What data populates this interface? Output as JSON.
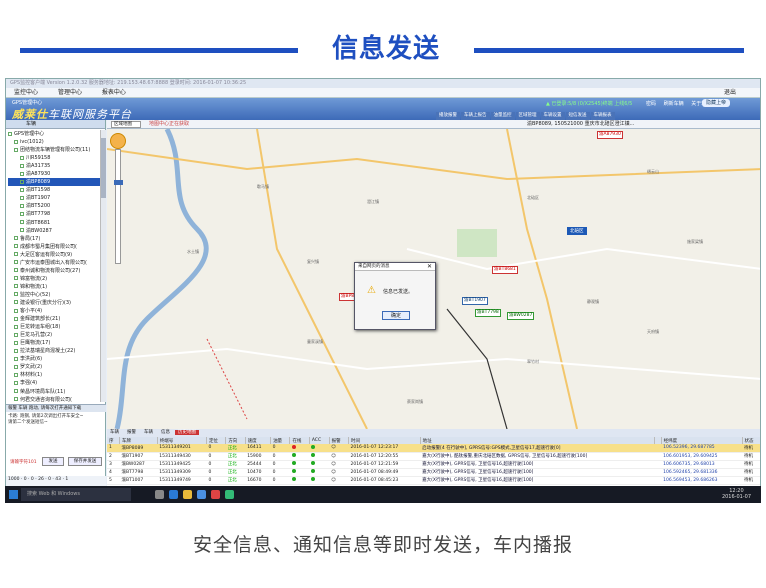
{
  "banner": {
    "title": "信息发送",
    "caption": "安全信息、通知信息等即时发送，车内播报"
  },
  "app": {
    "window_title": "GPS监控客户端 Version 1.2.0.32  服务器地址: 219.153.48.67:8888  登录时间: 2016-01-07 10:36:25",
    "menu": [
      "监控中心",
      "管理中心",
      "报表中心"
    ],
    "exit_label": "退出",
    "header": {
      "gps_label": "GPS管理中心",
      "logo_text": "威莱仕",
      "logo_sub": "车联网服务平台",
      "status_text": "▲ 已登录:5/8 (0/X2545)终端 上线6/5",
      "links": [
        "密码",
        "刷新车辆",
        "关于软件"
      ],
      "online_button": "隐藏上帝"
    },
    "tabs": [
      "播放报警",
      "车辆上报告",
      "油量监控",
      "区域管理",
      "车辆设置",
      "短信发送",
      "车辆报表"
    ],
    "left_panel": {
      "header": "车辆",
      "tree": [
        {
          "label": "GPS管理中心",
          "level": 0,
          "type": "group"
        },
        {
          "label": "ivc(1012)",
          "level": 1,
          "type": "group"
        },
        {
          "label": "团结物流车辆管理有限公司(11)",
          "level": 1,
          "type": "group"
        },
        {
          "label": "川R59158",
          "level": 2,
          "type": "car"
        },
        {
          "label": "渝A31735",
          "level": 2,
          "type": "car"
        },
        {
          "label": "渝A87930",
          "level": 2,
          "type": "car"
        },
        {
          "label": "渝BP8089",
          "level": 2,
          "type": "car",
          "selected": true
        },
        {
          "label": "渝BT1598",
          "level": 2,
          "type": "car"
        },
        {
          "label": "渝BT1907",
          "level": 2,
          "type": "car"
        },
        {
          "label": "渝BT5200",
          "level": 2,
          "type": "car"
        },
        {
          "label": "渝BT7798",
          "level": 2,
          "type": "car"
        },
        {
          "label": "渝BT8681",
          "level": 2,
          "type": "car"
        },
        {
          "label": "渝BW0287",
          "level": 2,
          "type": "car"
        },
        {
          "label": "鲁局(17)",
          "level": 1,
          "type": "group"
        },
        {
          "label": "成都市蜀月集团有限公司(",
          "level": 1,
          "type": "group"
        },
        {
          "label": "大足区客运有限公司(9)",
          "level": 1,
          "type": "group"
        },
        {
          "label": "广安市运泰围城出入有限公司(",
          "level": 1,
          "type": "group"
        },
        {
          "label": "泰州诚和物流有限公司(27)",
          "level": 1,
          "type": "group"
        },
        {
          "label": "锦富物流(2)",
          "level": 1,
          "type": "group"
        },
        {
          "label": "锦和物流(1)",
          "level": 1,
          "type": "group"
        },
        {
          "label": "监控中心(52)",
          "level": 1,
          "type": "group"
        },
        {
          "label": "建设银行(重庆分行)(3)",
          "level": 1,
          "type": "group"
        },
        {
          "label": "客小平(4)",
          "level": 1,
          "type": "group"
        },
        {
          "label": "金辉建筑部长(21)",
          "level": 1,
          "type": "group"
        },
        {
          "label": "巨龙转运车组(18)",
          "level": 1,
          "type": "group"
        },
        {
          "label": "巨龙马孔营(2)",
          "level": 1,
          "type": "group"
        },
        {
          "label": "巨鹰物流(17)",
          "level": 1,
          "type": "group"
        },
        {
          "label": "拉法基瑞星商混凝土(22)",
          "level": 1,
          "type": "group"
        },
        {
          "label": "李洪武(6)",
          "level": 1,
          "type": "group"
        },
        {
          "label": "罗文武(2)",
          "level": 1,
          "type": "group"
        },
        {
          "label": "林材料(1)",
          "level": 1,
          "type": "group"
        },
        {
          "label": "李强(4)",
          "level": 1,
          "type": "group"
        },
        {
          "label": "荣昌环境局车队(11)",
          "level": 1,
          "type": "group"
        },
        {
          "label": "何君交通咨询有限公司(",
          "level": 1,
          "type": "group"
        }
      ],
      "lower_tabs": "報警  车辆 跑动, 请每次打开通知下载",
      "messages": [
        "卡路: 跑钢, 请第2次调出打开车安全~",
        "请第二个发送短信~"
      ],
      "send_label": "请输字符101",
      "send_button": "发送",
      "save_send_button": "保存并发送",
      "footer": [
        "1000",
        "0",
        "0",
        "26",
        "0",
        "43",
        "1"
      ]
    },
    "map_toolbar": {
      "select_value": "区域地图",
      "center_text": "地图中心正在获取",
      "address_text": "渝BP8089, 150521000 重庆市北碚区澄江镇..."
    },
    "map": {
      "place_labels": [
        "北碚区",
        "缙云山",
        "歇马镇",
        "澄江镇",
        "龙凤桥",
        "童家溪镇",
        "静观镇",
        "蔡家岗镇",
        "水土镇",
        "施家梁镇",
        "天府镇",
        "翠竹村",
        "复兴镇"
      ],
      "cars": [
        {
          "label": "渝A87930",
          "color": "red"
        },
        {
          "label": "渝BT8681",
          "color": "red"
        },
        {
          "label": "渝BP80",
          "color": "red"
        },
        {
          "label": "渝BT1907",
          "color": "blue"
        },
        {
          "label": "渝BT7798",
          "color": "green"
        },
        {
          "label": "渝BW0287",
          "color": "green"
        }
      ],
      "area_tag": "北碚区"
    },
    "dialog": {
      "title": "来自网页的消息",
      "message": "信息已发送。",
      "ok_button": "确定"
    },
    "bottom_tabs": [
      "车辆",
      "报警",
      "车辆",
      "信息",
      "历史地图"
    ],
    "grid": {
      "columns": [
        "序",
        "车牌",
        "终端号",
        "定位",
        "方向",
        "速度",
        "油量",
        "在线",
        "ACC",
        "报警",
        "时间",
        "地址",
        "",
        "经纬度",
        "状态"
      ],
      "rows": [
        {
          "no": "1",
          "plate": "渝BP8089",
          "id": "15311349201",
          "loc": "0",
          "dir": "正北",
          "spd": "16411",
          "oil": "0",
          "time": "2016-01-07 12:23:17",
          "addr": "启动报警[4 在行驶中], GPRS信号:GPS模式,卫星信号17,超速行驶[0]",
          "coord": "106.52396, 29.687785",
          "st": "待机",
          "hl": true
        },
        {
          "no": "2",
          "plate": "渝BT1907",
          "id": "15311349430",
          "loc": "0",
          "dir": "正北",
          "spd": "15900",
          "oil": "0",
          "time": "2016-01-07 12:20:55",
          "addr": "嘉大(X行驶中), 酷钛报警,重庆北碚区数据, GPRS信号, 卫星信号16,超速行驶[100]",
          "coord": "106.601953, 29.609425",
          "st": "待机"
        },
        {
          "no": "3",
          "plate": "渝BW0287",
          "id": "15311349425",
          "loc": "0",
          "dir": "正北",
          "spd": "25444",
          "oil": "0",
          "time": "2016-01-07 12:21:59",
          "addr": "嘉大(X行驶中), GPRS信号, 卫星信号16,超速行驶[100]",
          "coord": "106.606735, 29.68013",
          "st": "待机"
        },
        {
          "no": "4",
          "plate": "渝BT7798",
          "id": "15311349309",
          "loc": "0",
          "dir": "正北",
          "spd": "10470",
          "oil": "0",
          "time": "2016-01-07 08:49:49",
          "addr": "嘉大(X行驶中), GPRS信号, 卫星信号16,超速行驶[100]",
          "coord": "106.592465, 29.681336",
          "st": "待机"
        },
        {
          "no": "5",
          "plate": "渝BT1007",
          "id": "15311349749",
          "loc": "0",
          "dir": "正北",
          "spd": "16670",
          "oil": "0",
          "time": "2016-01-07 08:45:23",
          "addr": "嘉大(X行驶中), GPRS信号, 卫星信号16,超速行驶[100]",
          "coord": "106.569453, 29.686263",
          "st": "待机"
        }
      ]
    },
    "statusbar": {
      "user": "用户名: admin",
      "state1": "通信状态",
      "state2": "数据库连接状态",
      "state3": "在线总数:",
      "count": "1083",
      "state4": "打开或关闭声音"
    }
  },
  "taskbar": {
    "search_placeholder": "搜索 Web 和 Windows",
    "time": "12:20",
    "date": "2016-01-07"
  }
}
